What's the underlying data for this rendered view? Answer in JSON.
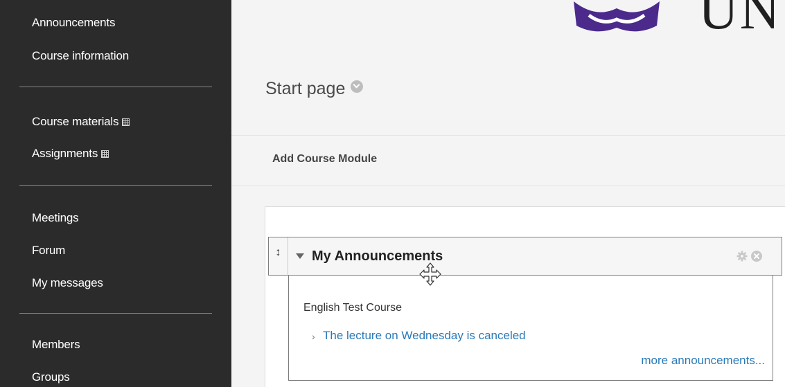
{
  "sidebar": {
    "items": [
      {
        "label": "Announcements"
      },
      {
        "label": "Course information"
      },
      {
        "label": "Course materials"
      },
      {
        "label": "Assignments"
      },
      {
        "label": "Meetings"
      },
      {
        "label": "Forum"
      },
      {
        "label": "My messages"
      },
      {
        "label": "Members"
      },
      {
        "label": "Groups"
      }
    ]
  },
  "header": {
    "logo_text": "UN",
    "logo_color": "#4b2a8c"
  },
  "page": {
    "title": "Start page",
    "add_module_label": "Add Course Module"
  },
  "module": {
    "title": "My Announcements",
    "course_name": "English Test Course",
    "announcement": "The lecture on Wednesday is canceled",
    "more_link": "more announcements..."
  },
  "icons": {
    "drag": "drag-handle-icon",
    "collapse": "collapse-triangle-icon",
    "gear": "gear-icon",
    "close": "close-icon",
    "cursor": "move-cursor-icon"
  },
  "colors": {
    "sidebar_bg": "#2b2b2b",
    "link": "#2a7ab8"
  }
}
